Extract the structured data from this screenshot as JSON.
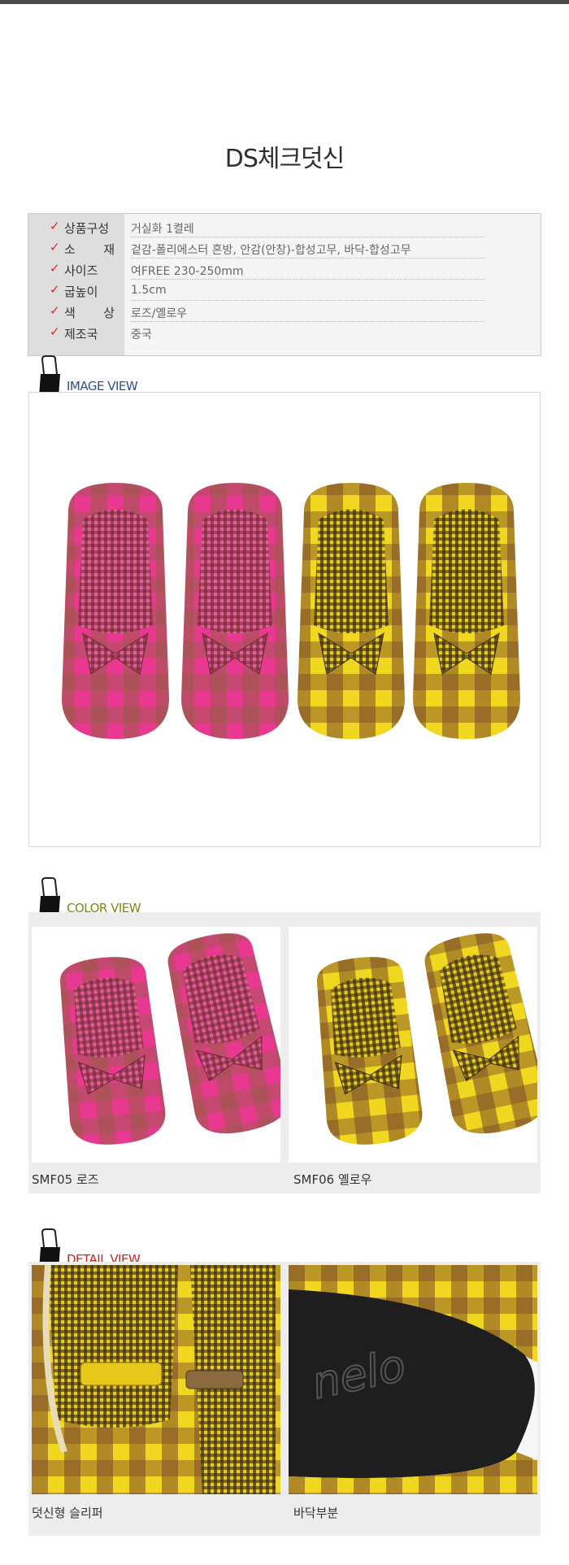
{
  "page": {
    "title": "DS체크덧신"
  },
  "spec": {
    "rows": [
      {
        "label": "상품구성",
        "value": "거실화 1켤레"
      },
      {
        "label": "소 재",
        "value": "겉감-폴리에스터 혼방, 안감(안창)-합성고무, 바닥-합성고무"
      },
      {
        "label": "사이즈",
        "value": "여FREE 230-250mm"
      },
      {
        "label": "굽높이",
        "value": "1.5cm"
      },
      {
        "label": "색 상",
        "value": "로즈/옐로우"
      },
      {
        "label": "제조국",
        "value": "중국"
      }
    ]
  },
  "sections": {
    "image_view": "IMAGE VIEW",
    "color_view": "COLOR VIEW",
    "detail_view": "DETAIL VIEW"
  },
  "colors": {
    "items": [
      {
        "caption": "SMF05 로즈",
        "main": "#e8388f",
        "accent": "#8b5a3c"
      },
      {
        "caption": "SMF06 옐로우",
        "main": "#e8d21f",
        "accent": "#7a4a2a"
      }
    ]
  },
  "details": {
    "items": [
      {
        "caption": "덧신형 슬리퍼"
      },
      {
        "caption": "바닥부분"
      }
    ],
    "sole_logo": "nelo"
  },
  "palette": {
    "section_image": "#2f4f8f",
    "section_color": "#7a8a16",
    "section_detail": "#cc1f1f",
    "check_mark": "#d22a2a"
  }
}
